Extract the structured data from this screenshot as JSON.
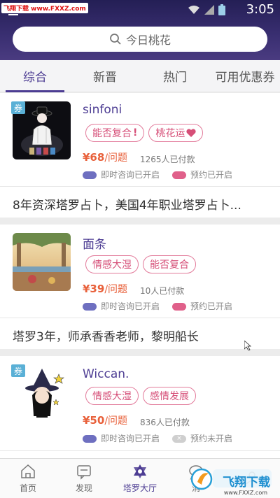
{
  "status_bar": {
    "watermark": "飞翔下载 www.FXXZ.com",
    "time": "3:05"
  },
  "search": {
    "placeholder": "今日桃花"
  },
  "tabs": [
    {
      "label": "综合"
    },
    {
      "label": "新晋"
    },
    {
      "label": "热门"
    },
    {
      "label": "可用优惠券"
    }
  ],
  "coupon_badge": "券",
  "cards": [
    {
      "name": "sinfoni",
      "tags": [
        {
          "label": "能否复合",
          "icon": "exclamation"
        },
        {
          "label": "桃花运",
          "icon": "heart"
        }
      ],
      "price": "¥68",
      "price_unit": "/问题",
      "paid": "1265人已付款",
      "instant": "即时咨询已开启",
      "booking": "预约已开启",
      "description": "8年资深塔罗占卜，美国4年职业塔罗占卜..."
    },
    {
      "name": "面条",
      "tags": [
        {
          "label": "情感大湿"
        },
        {
          "label": "能否复合"
        }
      ],
      "price": "¥39",
      "price_unit": "/问题",
      "paid": "10人已付款",
      "instant": "即时咨询已开启",
      "booking": "预约已开启",
      "description": "塔罗3年，师承香香老师，黎明船长"
    },
    {
      "name": "Wiccan.",
      "tags": [
        {
          "label": "情感大湿"
        },
        {
          "label": "感情发展"
        }
      ],
      "price": "¥50",
      "price_unit": "/问题",
      "paid": "836人已付款",
      "instant": "即时咨询已开启",
      "booking": "预约未开启"
    }
  ],
  "bottom_nav": [
    {
      "label": "首页",
      "icon": "home-icon"
    },
    {
      "label": "发现",
      "icon": "discover-icon"
    },
    {
      "label": "塔罗大厅",
      "icon": "tarot-hall-icon"
    },
    {
      "label": "消",
      "icon": "message-icon"
    },
    {
      "label": "",
      "icon": "profile-icon"
    }
  ],
  "logo_watermark": {
    "text": "飞翔下载",
    "url": "www.FXXZ.com"
  },
  "colors": {
    "accent": "#4d3d93",
    "pink": "#d64f78",
    "price": "#e8603a",
    "header": "#2c2660"
  }
}
